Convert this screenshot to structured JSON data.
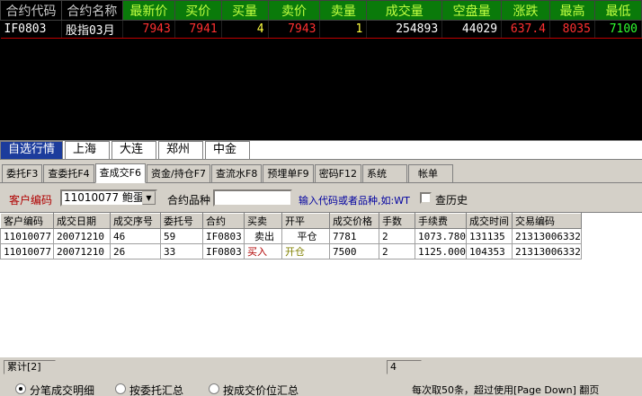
{
  "quote": {
    "headers": [
      "合约代码",
      "合约名称",
      "最新价",
      "买价",
      "买量",
      "卖价",
      "卖量",
      "成交量",
      "空盘量",
      "涨跌",
      "最高",
      "最低"
    ],
    "row": {
      "code": "IF0803",
      "name": "股指03月",
      "last": "7943",
      "bid": "7941",
      "bid_vol": "4",
      "ask": "7943",
      "ask_vol": "1",
      "volume": "254893",
      "open_interest": "44029",
      "change": "637.4",
      "high": "8035",
      "low": "7100"
    },
    "colors": {
      "price_red": "#ff3030",
      "neutral": "#ffffff",
      "volume_yellow": "#ffff40",
      "header_green": "#0a7a0a",
      "low_green": "#30ff30"
    }
  },
  "market_tabs": [
    "自选行情",
    "上海",
    "大连",
    "郑州",
    "中金"
  ],
  "func_tabs": [
    "委托F3",
    "查委托F4",
    "查成交F6",
    "资金/持仓F7",
    "查流水F8",
    "预埋单F9",
    "密码F12",
    "系统",
    "帐单"
  ],
  "filter": {
    "client_label": "客户编码",
    "client_value": "11010077 鲍蛋",
    "product_label": "合约品种",
    "product_value": "",
    "hint": "输入代码或者品种,如:WT",
    "history_label": "查历史"
  },
  "grid": {
    "headers": [
      "客户编码",
      "成交日期",
      "成交序号",
      "委托号",
      "合约",
      "买卖",
      "开平",
      "成交价格",
      "手数",
      "手续费",
      "成交时间",
      "交易编码"
    ],
    "rows": [
      [
        "11010077",
        "20071210",
        "46",
        "59",
        "IF0803",
        "卖出",
        "平仓",
        "7781",
        "2",
        "1073.780",
        "131135",
        "21313006332"
      ],
      [
        "11010077",
        "20071210",
        "26",
        "33",
        "IF0803",
        "买入",
        "开仓",
        "7500",
        "2",
        "1125.000",
        "104353",
        "21313006332"
      ]
    ]
  },
  "totals": {
    "label": "累计[2]",
    "count": "4"
  },
  "options": {
    "items": [
      "分笔成交明细",
      "按委托汇总",
      "按成交价位汇总"
    ],
    "selected_index": 0,
    "page_hint": "每次取50条，超过使用[Page Down] 翻页"
  }
}
